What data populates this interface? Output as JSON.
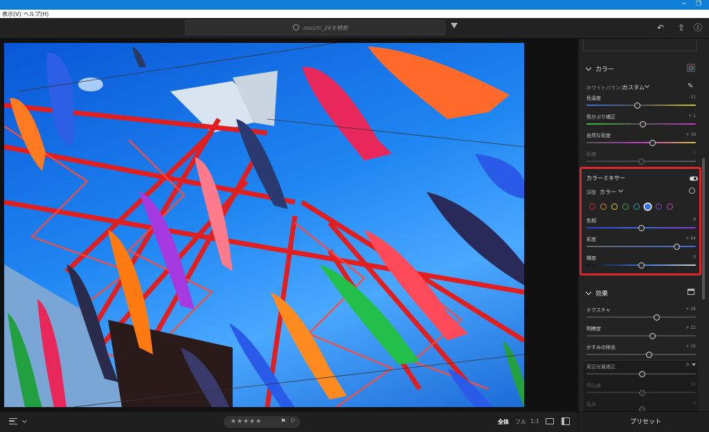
{
  "menu": {
    "view": "表示(V)",
    "help": "ヘルプ(H)"
  },
  "search": {
    "placeholder": "nocchi_24を検索"
  },
  "panel": {
    "color": {
      "title": "カラー",
      "wb_label": "ホワイトバランス",
      "wb_value": "カスタム",
      "sliders": [
        {
          "label": "色温度",
          "value": "- 11",
          "level": 0.46
        },
        {
          "label": "色かぶり補正",
          "value": "+ 1",
          "level": 0.51
        },
        {
          "label": "自然な彩度",
          "value": "+ 19",
          "level": 0.6
        },
        {
          "label": "彩度",
          "value": "0",
          "level": 0.5
        }
      ]
    },
    "mixer": {
      "title": "カラーミキサー",
      "adjust_label": "調整",
      "adjust_value": "カラー",
      "swatches": [
        "#e0262d",
        "#f08a1c",
        "#e8c81e",
        "#3fb43a",
        "#21a9a9",
        "#2f6ee8",
        "#8b3fd8",
        "#d43fc2"
      ],
      "selected_swatch": 5,
      "sliders": [
        {
          "label": "色相",
          "value": "0",
          "level": 0.5
        },
        {
          "label": "彩度",
          "value": "+ 64",
          "level": 0.82
        },
        {
          "label": "輝度",
          "value": "0",
          "level": 0.5
        }
      ]
    },
    "effects": {
      "title": "効果",
      "sliders": [
        {
          "label": "テクスチャ",
          "value": "+ 29",
          "level": 0.64
        },
        {
          "label": "明瞭度",
          "value": "+ 21",
          "level": 0.6
        },
        {
          "label": "かすみの除去",
          "value": "+ 15",
          "level": 0.57
        }
      ],
      "vignette": {
        "label": "周辺光量補正",
        "value": "0"
      },
      "vignette_sub": [
        {
          "label": "中心点",
          "value": "50"
        },
        {
          "label": "丸み",
          "value": "0"
        }
      ]
    }
  },
  "bottom": {
    "stars": "★★★★★",
    "view_all": "全体",
    "view_full": "フル",
    "view_1to1": "1:1",
    "presets": "プリセット"
  },
  "colors": {
    "accent_red": "#e0262d",
    "panel_bg": "#232323",
    "titlebar": "#0f7fd8"
  }
}
